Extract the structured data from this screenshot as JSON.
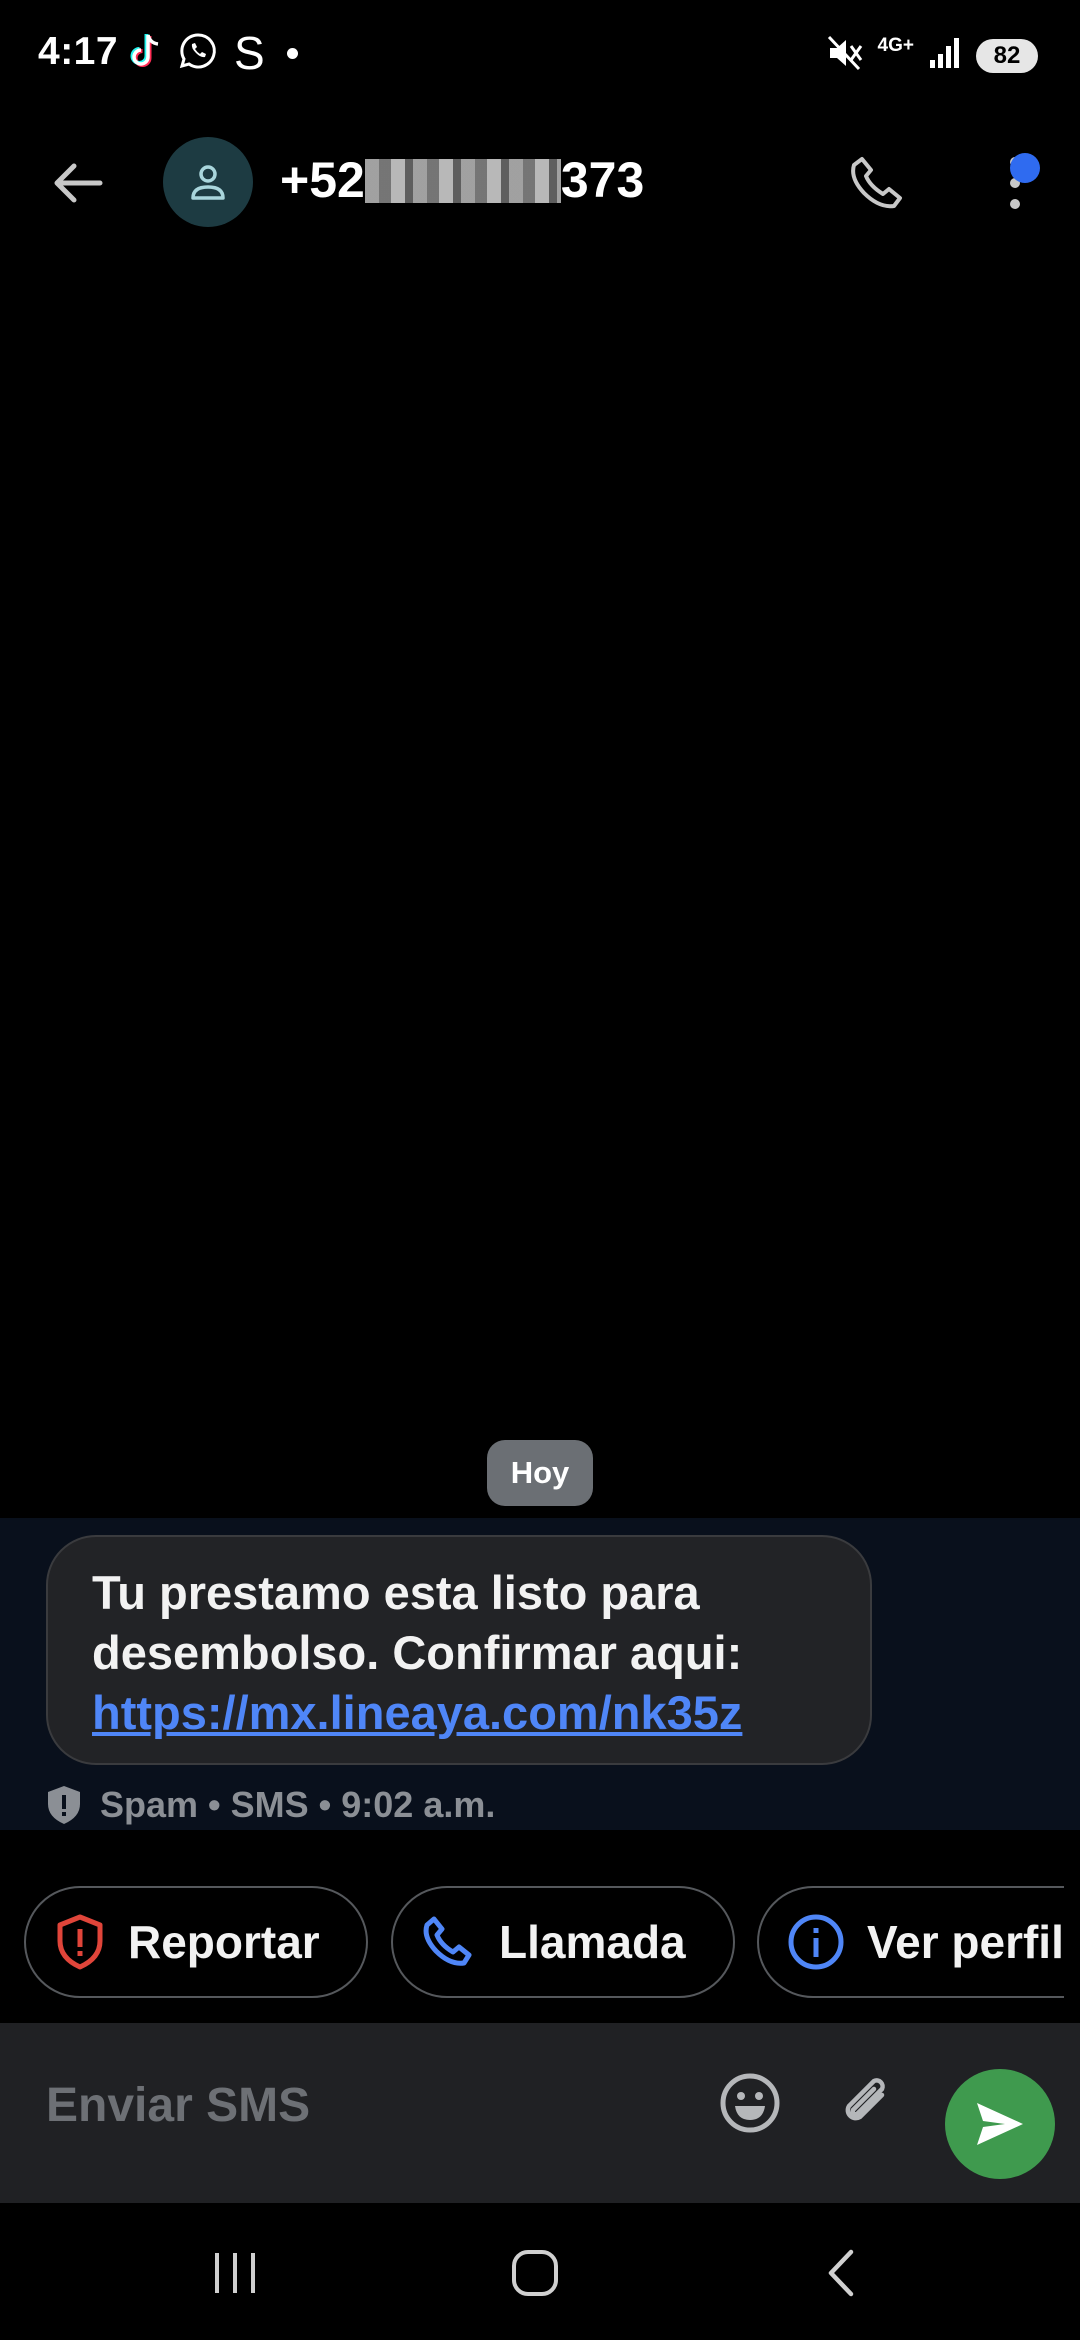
{
  "status_bar": {
    "time": "4:17",
    "s_label": "S",
    "network": "4G+",
    "battery": "82"
  },
  "header": {
    "contact_prefix": "+52",
    "contact_suffix": "373"
  },
  "date_chip": "Hoy",
  "message": {
    "text": "Tu prestamo esta listo para desembolso. Confirmar aqui:",
    "link": "https://mx.lineaya.com/nk35z",
    "meta": "Spam • SMS • 9:02 a.m."
  },
  "chips": [
    {
      "label": "Reportar",
      "icon": "shield-alert-icon"
    },
    {
      "label": "Llamada",
      "icon": "phone-icon"
    },
    {
      "label": "Ver perfil",
      "icon": "info-icon"
    }
  ],
  "composer": {
    "placeholder": "Enviar SMS"
  },
  "colors": {
    "accent_blue": "#4f86f7",
    "send_green": "#3f9a4e",
    "report_red": "#e0453a",
    "badge_blue": "#2f6bf0"
  }
}
